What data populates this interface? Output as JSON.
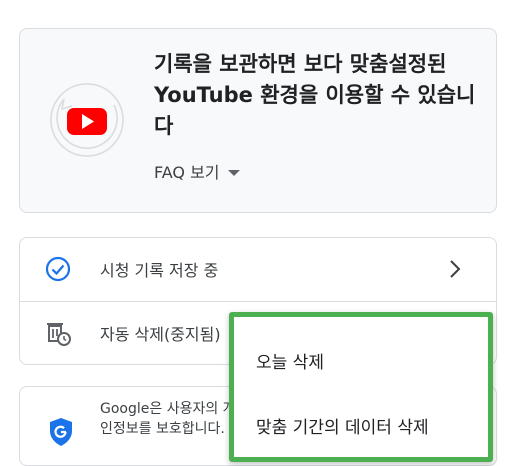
{
  "promo": {
    "title": "기록을 보관하면 보다 맞춤설정된 YouTube 환경을 이용할 수 있습니다",
    "faq_label": "FAQ 보기"
  },
  "settings": {
    "items": [
      {
        "label": "시청 기록 저장 중",
        "icon": "check-circle-icon"
      },
      {
        "label": "자동 삭제(중지됨)",
        "icon": "auto-delete-icon"
      }
    ]
  },
  "privacy": {
    "text": "Google은 사용자의 개인정보를 보호합니다."
  },
  "menu": {
    "items": [
      "오늘 삭제",
      "맞춤 기간의 데이터 삭제"
    ]
  },
  "colors": {
    "accent_blue": "#1a73e8",
    "youtube_red": "#ff0000",
    "highlight_green": "#4caf50"
  }
}
